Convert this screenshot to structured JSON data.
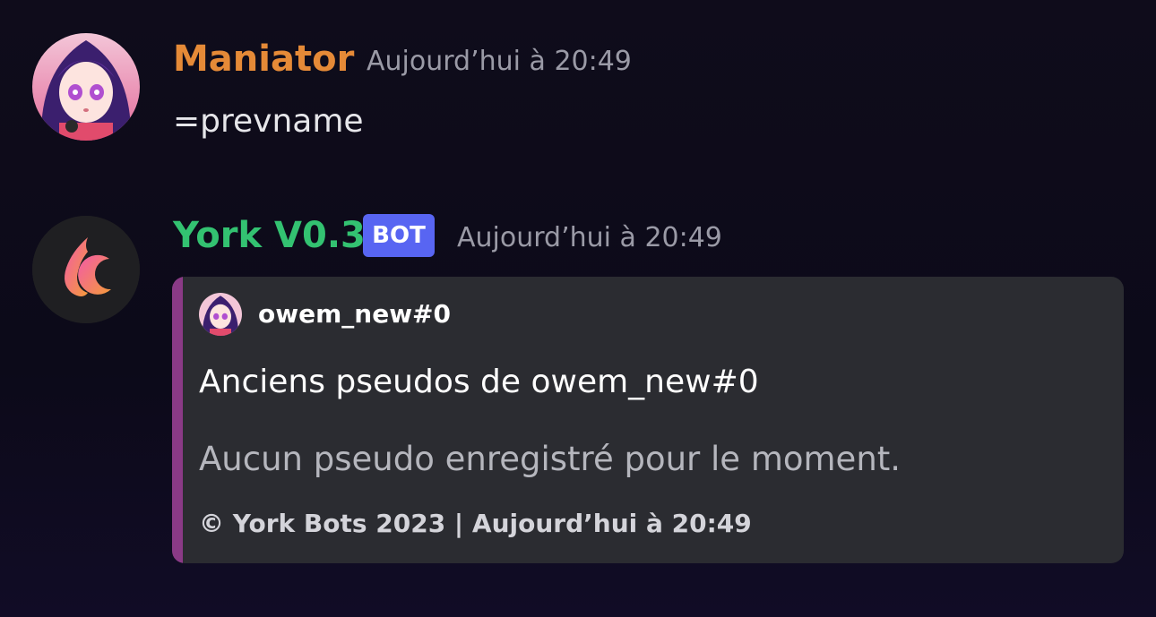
{
  "colors": {
    "background": "#0f0c1b",
    "user_name_color": "#e58a37",
    "bot_name_color": "#33c271",
    "bot_tag_color": "#5865f2",
    "embed_bar_color": "#8a3a86",
    "embed_bg": "#2b2c31",
    "timestamp_color": "#9a9aa6"
  },
  "messages": [
    {
      "author": "Maniator",
      "timestamp": "Aujourd’hui à 20:49",
      "content": "=prevname",
      "avatar_icon": "anime-avatar-icon"
    },
    {
      "author": "York V0.3",
      "bot_tag": "BOT",
      "timestamp": "Aujourd’hui à 20:49",
      "avatar_icon": "flame-moon-logo-icon",
      "embed": {
        "author_name": "owem_new#0",
        "author_icon": "anime-avatar-icon",
        "title": "Anciens pseudos de owem_new#0",
        "description": "Aucun pseudo enregistré pour le moment.",
        "footer": "© York Bots 2023 | Aujourd’hui à 20:49"
      }
    }
  ]
}
